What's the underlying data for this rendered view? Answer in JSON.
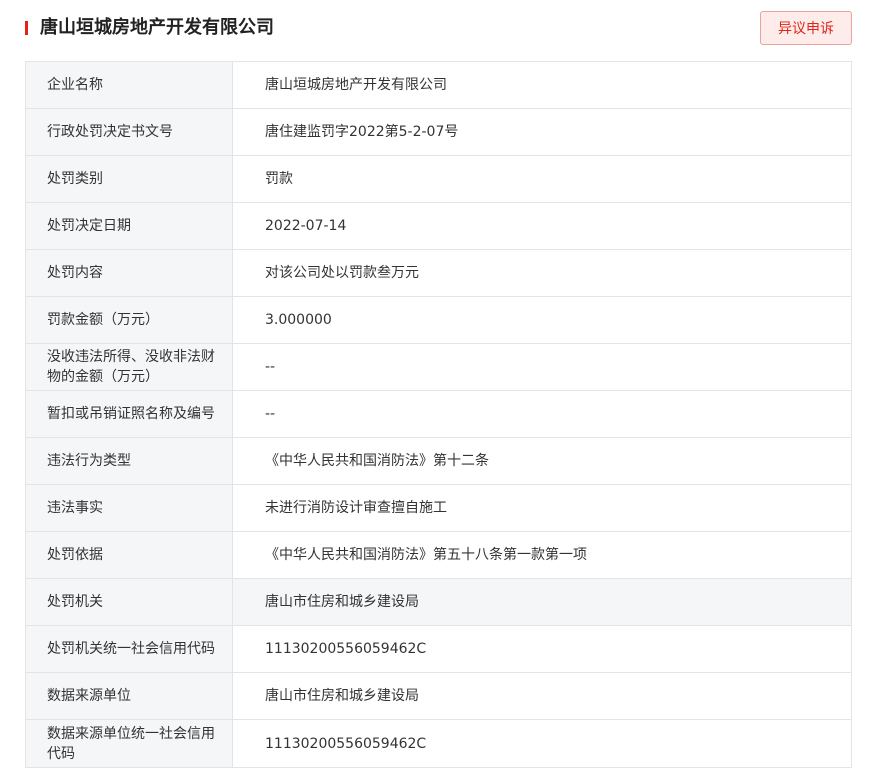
{
  "header": {
    "title": "唐山垣城房地产开发有限公司",
    "appeal_button": "异议申诉"
  },
  "rows": [
    {
      "label": "企业名称",
      "value": "唐山垣城房地产开发有限公司"
    },
    {
      "label": "行政处罚决定书文号",
      "value": "唐住建监罚字2022第5-2-07号"
    },
    {
      "label": "处罚类别",
      "value": "罚款"
    },
    {
      "label": "处罚决定日期",
      "value": "2022-07-14"
    },
    {
      "label": "处罚内容",
      "value": "对该公司处以罚款叁万元"
    },
    {
      "label": "罚款金额（万元）",
      "value": "3.000000"
    },
    {
      "label": "没收违法所得、没收非法财物的金额（万元）",
      "value": "--"
    },
    {
      "label": "暂扣或吊销证照名称及编号",
      "value": "--"
    },
    {
      "label": "违法行为类型",
      "value": "《中华人民共和国消防法》第十二条"
    },
    {
      "label": "违法事实",
      "value": "未进行消防设计审查擅自施工"
    },
    {
      "label": "处罚依据",
      "value": "《中华人民共和国消防法》第五十八条第一款第一项"
    },
    {
      "label": "处罚机关",
      "value": "唐山市住房和城乡建设局"
    },
    {
      "label": "处罚机关统一社会信用代码",
      "value": "11130200556059462C"
    },
    {
      "label": "数据来源单位",
      "value": "唐山市住房和城乡建设局"
    },
    {
      "label": "数据来源单位统一社会信用代码",
      "value": "11130200556059462C"
    }
  ]
}
